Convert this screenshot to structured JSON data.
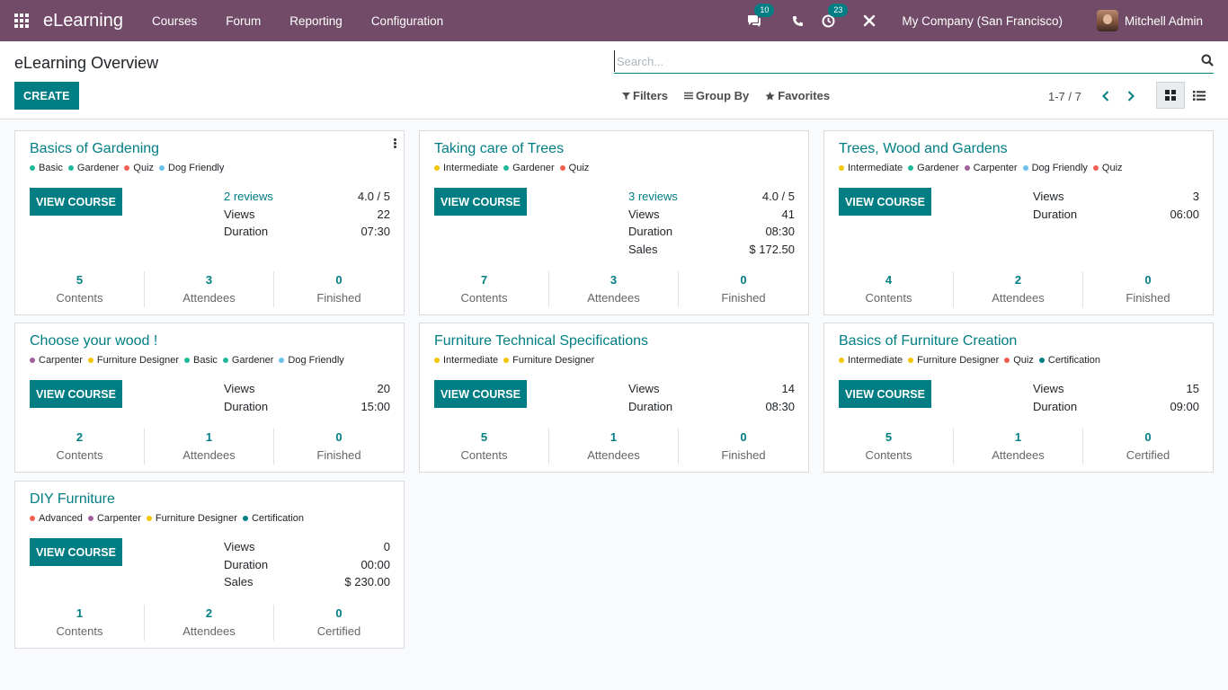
{
  "navbar": {
    "brand": "eLearning",
    "menu": [
      "Courses",
      "Forum",
      "Reporting",
      "Configuration"
    ],
    "messages_count": "10",
    "activities_count": "23",
    "company": "My Company (San Francisco)",
    "user": "Mitchell Admin"
  },
  "control_panel": {
    "title": "eLearning Overview",
    "create_label": "CREATE",
    "search_placeholder": "Search...",
    "filters_label": "Filters",
    "groupby_label": "Group By",
    "favorites_label": "Favorites",
    "pager": "1-7 / 7"
  },
  "colors": {
    "navbar": "#714b67",
    "primary": "#017e84",
    "dot_green": "#21b799",
    "dot_red": "#f06050",
    "dot_cyan": "#6cc1ed",
    "dot_yellow": "#f4c609",
    "dot_purple": "#a15f9c",
    "dot_teal": "#017e84"
  },
  "courses": [
    {
      "title": "Basics of Gardening",
      "tags": [
        {
          "label": "Basic",
          "color": "#21b799"
        },
        {
          "label": "Gardener",
          "color": "#21b799"
        },
        {
          "label": "Quiz",
          "color": "#f06050"
        },
        {
          "label": "Dog Friendly",
          "color": "#6cc1ed"
        }
      ],
      "button": "VIEW COURSE",
      "stats": [
        {
          "label": "2 reviews",
          "value": "4.0 / 5",
          "link": true
        },
        {
          "label": "Views",
          "value": "22"
        },
        {
          "label": "Duration",
          "value": "07:30"
        }
      ],
      "footer": [
        {
          "num": "5",
          "label": "Contents"
        },
        {
          "num": "3",
          "label": "Attendees"
        },
        {
          "num": "0",
          "label": "Finished"
        }
      ]
    },
    {
      "title": "Taking care of Trees",
      "tags": [
        {
          "label": "Intermediate",
          "color": "#f4c609"
        },
        {
          "label": "Gardener",
          "color": "#21b799"
        },
        {
          "label": "Quiz",
          "color": "#f06050"
        }
      ],
      "button": "VIEW COURSE",
      "stats": [
        {
          "label": "3 reviews",
          "value": "4.0 / 5",
          "link": true
        },
        {
          "label": "Views",
          "value": "41"
        },
        {
          "label": "Duration",
          "value": "08:30"
        },
        {
          "label": "Sales",
          "value": "$ 172.50"
        }
      ],
      "footer": [
        {
          "num": "7",
          "label": "Contents"
        },
        {
          "num": "3",
          "label": "Attendees"
        },
        {
          "num": "0",
          "label": "Finished"
        }
      ]
    },
    {
      "title": "Trees, Wood and Gardens",
      "tags": [
        {
          "label": "Intermediate",
          "color": "#f4c609"
        },
        {
          "label": "Gardener",
          "color": "#21b799"
        },
        {
          "label": "Carpenter",
          "color": "#a15f9c"
        },
        {
          "label": "Dog Friendly",
          "color": "#6cc1ed"
        },
        {
          "label": "Quiz",
          "color": "#f06050"
        }
      ],
      "button": "VIEW COURSE",
      "stats": [
        {
          "label": "Views",
          "value": "3"
        },
        {
          "label": "Duration",
          "value": "06:00"
        }
      ],
      "footer": [
        {
          "num": "4",
          "label": "Contents"
        },
        {
          "num": "2",
          "label": "Attendees"
        },
        {
          "num": "0",
          "label": "Finished"
        }
      ]
    },
    {
      "title": "Choose your wood !",
      "tags": [
        {
          "label": "Carpenter",
          "color": "#a15f9c"
        },
        {
          "label": "Furniture Designer",
          "color": "#f4c609"
        },
        {
          "label": "Basic",
          "color": "#21b799"
        },
        {
          "label": "Gardener",
          "color": "#21b799"
        },
        {
          "label": "Dog Friendly",
          "color": "#6cc1ed"
        }
      ],
      "button": "VIEW COURSE",
      "stats": [
        {
          "label": "Views",
          "value": "20"
        },
        {
          "label": "Duration",
          "value": "15:00"
        }
      ],
      "footer": [
        {
          "num": "2",
          "label": "Contents"
        },
        {
          "num": "1",
          "label": "Attendees"
        },
        {
          "num": "0",
          "label": "Finished"
        }
      ]
    },
    {
      "title": "Furniture Technical Specifications",
      "tags": [
        {
          "label": "Intermediate",
          "color": "#f4c609"
        },
        {
          "label": "Furniture Designer",
          "color": "#f4c609"
        }
      ],
      "button": "VIEW COURSE",
      "stats": [
        {
          "label": "Views",
          "value": "14"
        },
        {
          "label": "Duration",
          "value": "08:30"
        }
      ],
      "footer": [
        {
          "num": "5",
          "label": "Contents"
        },
        {
          "num": "1",
          "label": "Attendees"
        },
        {
          "num": "0",
          "label": "Finished"
        }
      ]
    },
    {
      "title": "Basics of Furniture Creation",
      "tags": [
        {
          "label": "Intermediate",
          "color": "#f4c609"
        },
        {
          "label": "Furniture Designer",
          "color": "#f4c609"
        },
        {
          "label": "Quiz",
          "color": "#f06050"
        },
        {
          "label": "Certification",
          "color": "#017e84"
        }
      ],
      "button": "VIEW COURSE",
      "stats": [
        {
          "label": "Views",
          "value": "15"
        },
        {
          "label": "Duration",
          "value": "09:00"
        }
      ],
      "footer": [
        {
          "num": "5",
          "label": "Contents"
        },
        {
          "num": "1",
          "label": "Attendees"
        },
        {
          "num": "0",
          "label": "Certified"
        }
      ]
    },
    {
      "title": "DIY Furniture",
      "tags": [
        {
          "label": "Advanced",
          "color": "#f06050"
        },
        {
          "label": "Carpenter",
          "color": "#a15f9c"
        },
        {
          "label": "Furniture Designer",
          "color": "#f4c609"
        },
        {
          "label": "Certification",
          "color": "#017e84"
        }
      ],
      "button": "VIEW COURSE",
      "stats": [
        {
          "label": "Views",
          "value": "0"
        },
        {
          "label": "Duration",
          "value": "00:00"
        },
        {
          "label": "Sales",
          "value": "$ 230.00"
        }
      ],
      "footer": [
        {
          "num": "1",
          "label": "Contents"
        },
        {
          "num": "2",
          "label": "Attendees"
        },
        {
          "num": "0",
          "label": "Certified"
        }
      ]
    }
  ]
}
